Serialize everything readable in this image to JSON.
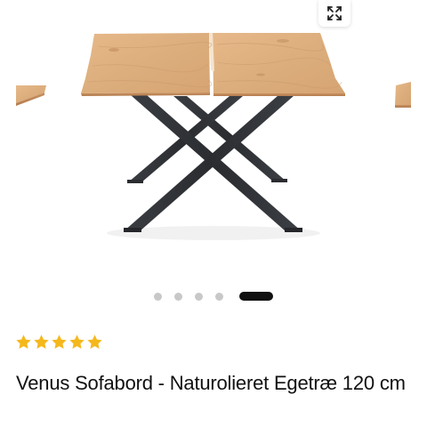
{
  "gallery": {
    "image_alt": "Venus Sofabord - Naturolieret Egetræ 120 cm",
    "slide_count": 5,
    "active_slide_index": 4
  },
  "expand_icon": "expand-arrows-icon",
  "rating": {
    "stars": 5,
    "max": 5,
    "star_color": "#f5b81c",
    "star_icon": "star-icon"
  },
  "product": {
    "title": "Venus Sofabord - Naturolieret Egetræ 120 cm"
  },
  "colors": {
    "dot_inactive": "#c8c8c8",
    "dot_active": "#111111",
    "text": "#111111"
  }
}
